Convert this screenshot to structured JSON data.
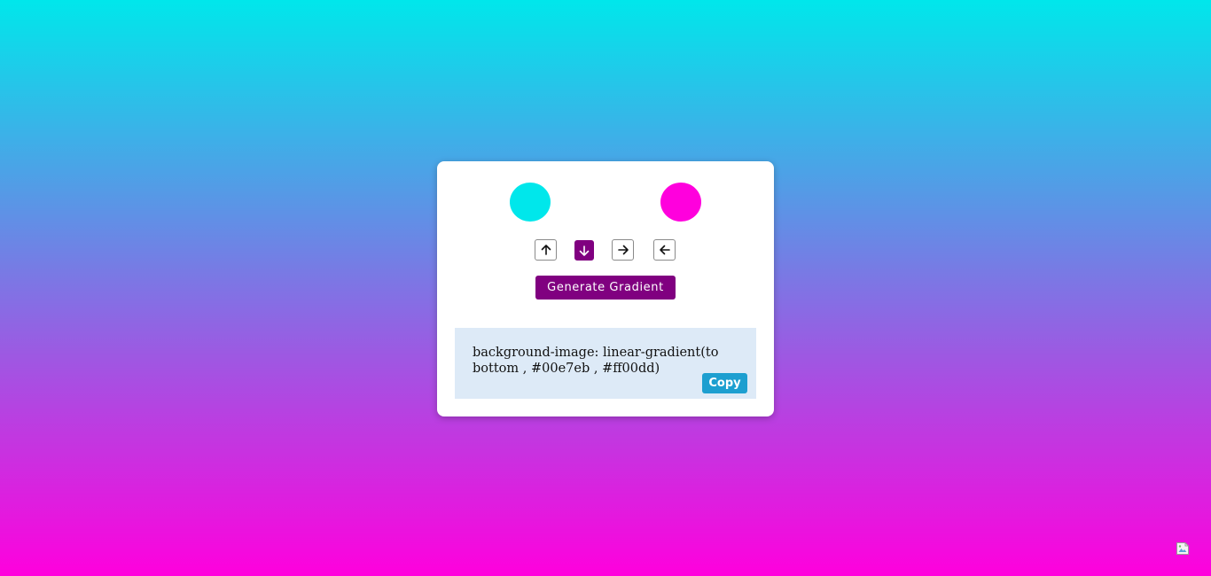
{
  "colors": {
    "start": "#00e7eb",
    "end": "#ff00dd",
    "accent": "#800080",
    "copy_button": "#1d9fd0",
    "output_bg": "#ddeaf7"
  },
  "directions": [
    {
      "name": "up",
      "icon": "arrow-up-icon",
      "active": false
    },
    {
      "name": "down",
      "icon": "arrow-down-icon",
      "active": true
    },
    {
      "name": "right",
      "icon": "arrow-right-icon",
      "active": false
    },
    {
      "name": "left",
      "icon": "arrow-left-icon",
      "active": false
    }
  ],
  "generate": {
    "label": "Generate Gradient"
  },
  "output": {
    "text": "background-image: linear-gradient(to bottom , #00e7eb , #ff00dd)",
    "copy_label": "Copy"
  },
  "corner_image": {
    "icon": "broken-image-icon"
  }
}
